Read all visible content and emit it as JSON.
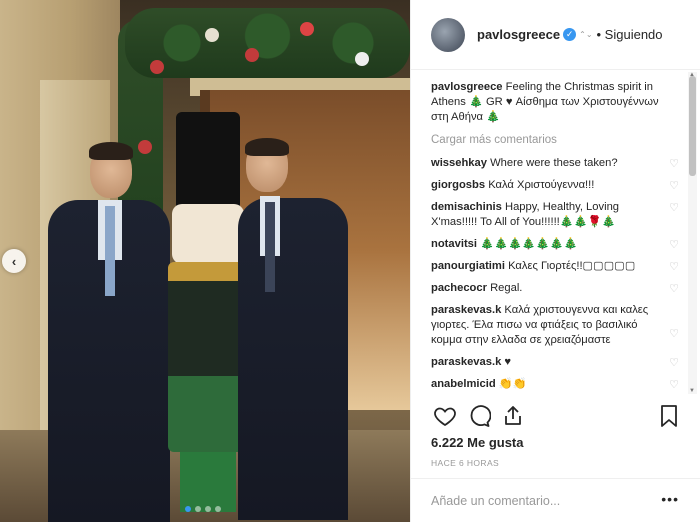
{
  "header": {
    "username": "pavlosgreece",
    "follow_status": "• Siguiendo"
  },
  "caption": {
    "username": "pavlosgreece",
    "text": "Feeling the Christmas spirit in Athens 🎄 GR ♥ Αίσθημα των Χριστουγέννων στη Αθήνα 🎄"
  },
  "load_more": "Cargar más comentarios",
  "comments": [
    {
      "user": "wissehkay",
      "text": "Where were these taken?"
    },
    {
      "user": "giorgosbs",
      "text": "Καλά Χριστούγεννα!!!"
    },
    {
      "user": "demisachinis",
      "text": "Happy, Healthy, Loving X'mas!!!!! To All of You!!!!!!🎄🎄🌹🎄"
    },
    {
      "user": "notavitsi",
      "text": "🎄🎄🎄🎄🎄🎄🎄"
    },
    {
      "user": "panourgiatimi",
      "text": "Καλες Γιορτές!!▢▢▢▢▢"
    },
    {
      "user": "pachecocr",
      "text": "Regal."
    },
    {
      "user": "paraskevas.k",
      "text": "Καλά χριστουγεννα και καλες γιορτες. Έλα πισω να φτιάξεις το βασιλικό κομμα στην ελλαδα σε χρειαζόμαστε"
    },
    {
      "user": "paraskevas.k",
      "text": "♥"
    },
    {
      "user": "anabelmicid",
      "text": "👏👏"
    }
  ],
  "likes": "6.222 Me gusta",
  "time_ago": "HACE 6 HORAS",
  "add_comment_placeholder": "Añade un comentario...",
  "more_label": "•••",
  "icons": {
    "like": "heart-icon",
    "comment": "comment-icon",
    "share": "share-icon",
    "save": "bookmark-icon",
    "verified": "verified-badge-icon"
  },
  "colors": {
    "accent": "#3897f0",
    "text": "#262626",
    "muted": "#999999",
    "border": "#efefef"
  },
  "carousel": {
    "count": 4,
    "active_index": 0
  }
}
